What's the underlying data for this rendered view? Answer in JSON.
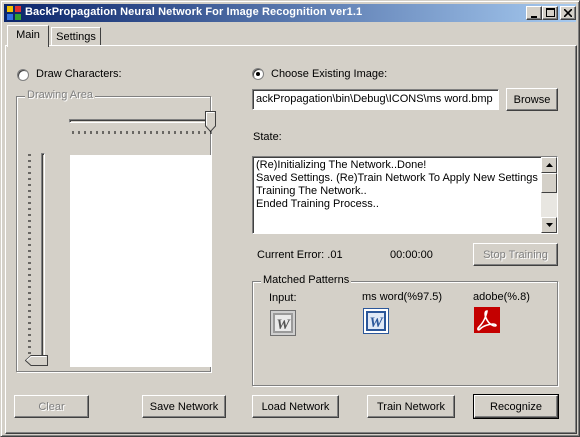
{
  "window": {
    "title": "BackPropagation Neural Network For Image Recognition ver1.1",
    "buttons": {
      "minimize": "_",
      "maximize": "□",
      "close": "×"
    }
  },
  "tabs": [
    {
      "label": "Main",
      "active": true
    },
    {
      "label": "Settings",
      "active": false
    }
  ],
  "draw_panel": {
    "radio_label": "Draw Characters:",
    "radio_checked": false,
    "group_label": "Drawing Area",
    "clear_button": "Clear",
    "save_network_button": "Save Network"
  },
  "image_panel": {
    "radio_label": "Choose Existing Image:",
    "radio_checked": true,
    "path_value": "ackPropagation\\bin\\Debug\\ICONS\\ms word.bmp",
    "browse_button": "Browse"
  },
  "state": {
    "label": "State:",
    "log": [
      "(Re)Initializing The Network..Done!",
      "Saved Settings. (Re)Train Network To Apply New Settings.",
      "Training The Network..",
      "Ended Training Process.."
    ],
    "current_error": "Current Error: .01",
    "elapsed_time": "00:00:00",
    "stop_training_button": "Stop Training"
  },
  "matched_patterns": {
    "group_label": "Matched Patterns",
    "input_label": "Input:",
    "input_icon": "word-gray-icon",
    "matches": [
      {
        "label": "ms word(%97.5)",
        "icon": "ms-word-icon",
        "color": "#2b579a"
      },
      {
        "label": "adobe(%.8)",
        "icon": "adobe-acrobat-icon",
        "color": "#c40000"
      }
    ]
  },
  "actions": {
    "load_network": "Load Network",
    "train_network": "Train Network",
    "recognize": "Recognize"
  },
  "colors": {
    "title_start": "#0a246a",
    "title_end": "#a6caf0",
    "face": "#d4d0c8"
  }
}
